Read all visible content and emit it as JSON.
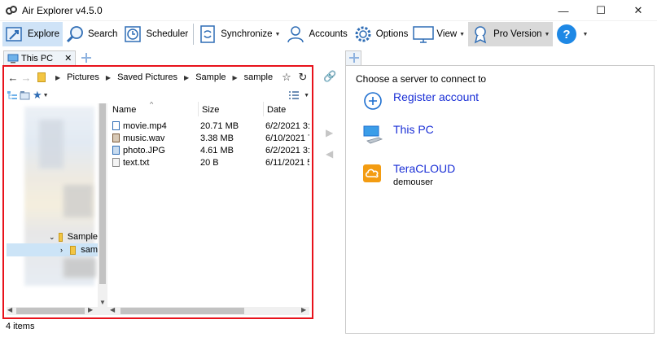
{
  "window": {
    "title": "Air Explorer v4.5.0",
    "controls": [
      "—",
      "☐",
      "✕"
    ]
  },
  "toolbar": {
    "explore": "Explore",
    "search": "Search",
    "scheduler": "Scheduler",
    "synchronize": "Synchronize",
    "accounts": "Accounts",
    "options": "Options",
    "view": "View",
    "pro_version": "Pro Version"
  },
  "tabs": {
    "left_tab": "This PC",
    "close": "✕"
  },
  "left": {
    "breadcrumb": [
      "Pictures",
      "Saved Pictures",
      "Sample",
      "sample"
    ],
    "tree": {
      "parent": "Sample",
      "selected": "sam"
    },
    "columns": [
      "Name",
      "Size",
      "Date"
    ],
    "files": [
      {
        "name": "movie.mp4",
        "size": "20.71 MB",
        "date": "6/2/2021 3:3",
        "icon": "video-file-icon"
      },
      {
        "name": "music.wav",
        "size": "3.38 MB",
        "date": "6/10/2021 7",
        "icon": "audio-file-icon"
      },
      {
        "name": "photo.JPG",
        "size": "4.61 MB",
        "date": "6/2/2021 3:3",
        "icon": "image-file-icon"
      },
      {
        "name": "text.txt",
        "size": "20 B",
        "date": "6/11/2021 5",
        "icon": "text-file-icon"
      }
    ],
    "status": "4 items"
  },
  "right": {
    "heading": "Choose a server to connect to",
    "servers": [
      {
        "label": "Register account",
        "sub": "",
        "icon": "plus-circle-icon"
      },
      {
        "label": "This PC",
        "sub": "",
        "icon": "computer-icon"
      },
      {
        "label": "TeraCLOUD",
        "sub": "demouser",
        "icon": "teracloud-icon"
      }
    ]
  },
  "colors": {
    "accent": "#1a2fd6",
    "highlight_border": "#e8121b",
    "selection": "#cce4f7",
    "teracloud": "#f39c12"
  }
}
